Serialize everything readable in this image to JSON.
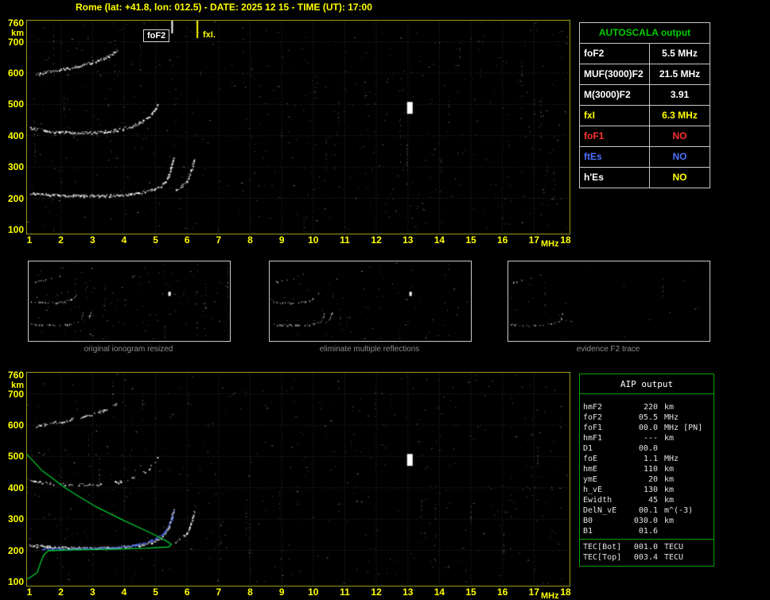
{
  "title": "Rome (lat: +41.8, lon: 012.5) - DATE: 2025 12 15 - TIME (UT): 17:00",
  "colors": {
    "title": "#ffff00",
    "axis_labels": "#ffff00",
    "plot_frame": "#9a9a1e",
    "grid": "#323232",
    "trace": "#ffffff",
    "profile_green": "#00cc33",
    "scaled_trace_blue": "#4f6fff",
    "fxI_yellow": "#ffff00",
    "no_red": "#ff3030",
    "no_blue": "#4f6fff",
    "autoscala_border": "#c8c8c8",
    "autoscala_header_green": "#00cc00",
    "aip_border": "#00a000",
    "caption_gray": "#8c8c8c"
  },
  "autoscala": {
    "header": "AUTOSCALA output",
    "rows": [
      {
        "label": "foF2",
        "value": "5.5 MHz",
        "label_color": "#ffffff",
        "value_color": "#ffffff"
      },
      {
        "label": "MUF(3000)F2",
        "value": "21.5 MHz",
        "label_color": "#ffffff",
        "value_color": "#ffffff"
      },
      {
        "label": "M(3000)F2",
        "value": "3.91",
        "label_color": "#ffffff",
        "value_color": "#ffffff"
      },
      {
        "label": "fxI",
        "value": "6.3 MHz",
        "label_color": "#ffff00",
        "value_color": "#ffff00"
      },
      {
        "label": "foF1",
        "value": "NO",
        "label_color": "#ff3030",
        "value_color": "#ff3030"
      },
      {
        "label": "ftEs",
        "value": "NO",
        "label_color": "#4f6fff",
        "value_color": "#4f6fff"
      },
      {
        "label": "h'Es",
        "value": "NO",
        "label_color": "#ffffff",
        "value_color": "#ffff00"
      }
    ]
  },
  "thumbnails": [
    {
      "caption": "original ionogram resized"
    },
    {
      "caption": "eliminate multiple reflections"
    },
    {
      "caption": "evidence F2 trace"
    }
  ],
  "aip": {
    "header": "AIP output",
    "rows": [
      {
        "name": "hmF2",
        "value": "220",
        "unit": "km",
        "extra": ""
      },
      {
        "name": "foF2",
        "value": "05.5",
        "unit": "MHz",
        "extra": ""
      },
      {
        "name": "foF1",
        "value": "00.0",
        "unit": "MHz",
        "extra": "[PN]"
      },
      {
        "name": "hmF1",
        "value": "---",
        "unit": "km",
        "extra": ""
      },
      {
        "name": "D1",
        "value": "00.0",
        "unit": "",
        "extra": ""
      },
      {
        "name": "foE",
        "value": "1.1",
        "unit": "MHz",
        "extra": ""
      },
      {
        "name": "hmE",
        "value": "110",
        "unit": "km",
        "extra": ""
      },
      {
        "name": "ymE",
        "value": "20",
        "unit": "km",
        "extra": ""
      },
      {
        "name": "h_vE",
        "value": "130",
        "unit": "km",
        "extra": ""
      },
      {
        "name": "Ewidth",
        "value": "45",
        "unit": "km",
        "extra": ""
      },
      {
        "name": "DelN_vE",
        "value": "00.1",
        "unit": "m^(-3)",
        "extra": ""
      },
      {
        "name": "B0",
        "value": "030.0",
        "unit": "km",
        "extra": ""
      },
      {
        "name": "B1",
        "value": "01.6",
        "unit": "",
        "extra": ""
      }
    ],
    "tec_rows": [
      {
        "name": "TEC[Bot]",
        "value": "001.0",
        "unit": "TECU"
      },
      {
        "name": "TEC[Top]",
        "value": "003.4",
        "unit": "TECU"
      }
    ]
  },
  "chart_data": {
    "type": "scatter",
    "title": "Ionogram - Rome 2025 12 15 17:00 UT",
    "xlabel": "MHz",
    "ylabel": "km",
    "xlim": [
      1,
      18
    ],
    "ylim": [
      100,
      760
    ],
    "x_ticks": [
      1,
      2,
      3,
      4,
      5,
      6,
      7,
      8,
      9,
      10,
      11,
      12,
      13,
      14,
      15,
      16,
      17,
      18
    ],
    "y_ticks": [
      760,
      700,
      600,
      500,
      400,
      300,
      200,
      100
    ],
    "grid": true,
    "annotations": {
      "foF2_label": "foF2",
      "fxI_label": "fxI.",
      "foF2_line_mhz": 5.5,
      "fxI_line_mhz": 6.3,
      "interference_marker": {
        "mhz": 13.05,
        "km_top": 508,
        "km_bottom": 470
      }
    },
    "traces": {
      "f2_o": [
        [
          1.0,
          218
        ],
        [
          1.6,
          212
        ],
        [
          2.4,
          209
        ],
        [
          3.2,
          209
        ],
        [
          4.0,
          212
        ],
        [
          4.5,
          218
        ],
        [
          4.9,
          228
        ],
        [
          5.2,
          243
        ],
        [
          5.35,
          262
        ],
        [
          5.45,
          287
        ],
        [
          5.52,
          315
        ],
        [
          5.56,
          332
        ]
      ],
      "f2_x": [
        [
          5.62,
          228
        ],
        [
          5.8,
          238
        ],
        [
          5.95,
          252
        ],
        [
          6.05,
          272
        ],
        [
          6.15,
          300
        ],
        [
          6.22,
          328
        ]
      ],
      "hop2": [
        [
          1.0,
          425
        ],
        [
          1.6,
          415
        ],
        [
          2.4,
          410
        ],
        [
          3.2,
          412
        ],
        [
          3.8,
          420
        ],
        [
          4.3,
          433
        ],
        [
          4.7,
          455
        ],
        [
          4.95,
          480
        ],
        [
          5.08,
          505
        ]
      ],
      "hop3": [
        [
          1.2,
          598
        ],
        [
          1.7,
          608
        ],
        [
          2.2,
          617
        ],
        [
          2.7,
          628
        ],
        [
          3.1,
          640
        ],
        [
          3.5,
          655
        ],
        [
          3.8,
          672
        ]
      ]
    },
    "profile_green": [
      [
        0.3,
        585
      ],
      [
        0.8,
        520
      ],
      [
        1.4,
        455
      ],
      [
        2.2,
        395
      ],
      [
        3.1,
        340
      ],
      [
        4.0,
        295
      ],
      [
        4.8,
        258
      ],
      [
        5.3,
        233
      ],
      [
        5.5,
        220
      ],
      [
        5.42,
        211
      ],
      [
        4.7,
        207
      ],
      [
        3.6,
        204
      ],
      [
        2.4,
        202
      ],
      [
        1.6,
        199
      ],
      [
        1.45,
        185
      ],
      [
        1.35,
        160
      ],
      [
        1.25,
        130
      ],
      [
        1.0,
        112
      ],
      [
        0.6,
        104
      ],
      [
        0.25,
        100
      ]
    ],
    "scaled_trace_blue": [
      [
        1.4,
        206
      ],
      [
        1.9,
        205
      ],
      [
        2.5,
        206
      ],
      [
        3.1,
        208
      ],
      [
        3.7,
        211
      ],
      [
        4.2,
        216
      ],
      [
        4.6,
        224
      ],
      [
        4.95,
        236
      ],
      [
        5.2,
        252
      ],
      [
        5.38,
        275
      ],
      [
        5.5,
        302
      ],
      [
        5.56,
        330
      ]
    ]
  }
}
